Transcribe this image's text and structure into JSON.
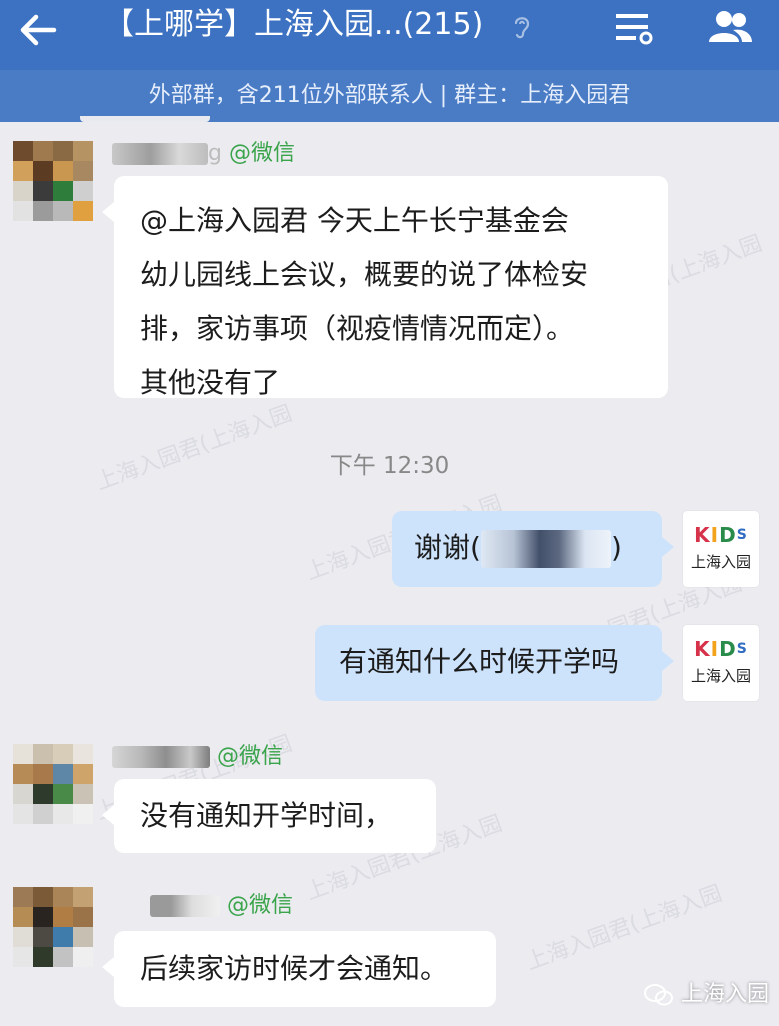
{
  "header": {
    "title": "【上哪学】上海入园...(215)",
    "subtitle": "外部群，含211位外部联系人 | 群主：上海入园君"
  },
  "watermark": "上海入园君(上海入园",
  "time_divider": "下午 12:30",
  "messages": [
    {
      "side": "left",
      "sender_suffix": "g",
      "sender_tag": "@微信",
      "lines": [
        "@上海入园君 今天上午长宁基金会",
        "幼儿园线上会议，概要的说了体检安",
        "排，家访事项（视疫情情况而定）。",
        "其他没有了"
      ]
    },
    {
      "side": "right",
      "text_prefix": "谢谢(",
      "text_suffix": ")",
      "avatar": {
        "logo": [
          "K",
          "I",
          "D",
          "S"
        ],
        "name": "上海入园"
      }
    },
    {
      "side": "right",
      "text": "有通知什么时候开学吗",
      "avatar": {
        "logo": [
          "K",
          "I",
          "D",
          "S"
        ],
        "name": "上海入园"
      }
    },
    {
      "side": "left",
      "sender_tag": "@微信",
      "text": "没有通知开学时间，"
    },
    {
      "side": "left",
      "sender_tag": "@微信",
      "text": "后续家访时候才会通知。"
    }
  ],
  "footer_mark": {
    "label": "上海入园"
  },
  "colors": {
    "header_bg": "#3d72c2",
    "subheader_bg": "#4a7cc6",
    "page_bg": "#ebebf0",
    "bubble_outgoing": "#cde3fb",
    "bubble_incoming": "#ffffff",
    "wechat_tag": "#3aa44b",
    "kids_letters": [
      "#d6334a",
      "#f2a21b",
      "#2a8c4a",
      "#2f6cc2"
    ]
  },
  "icons": {
    "back": "arrow-left-icon",
    "ear": "ear-icon",
    "menu": "list-settings-icon",
    "members": "group-members-icon",
    "footer": "wechat-logo-icon"
  }
}
